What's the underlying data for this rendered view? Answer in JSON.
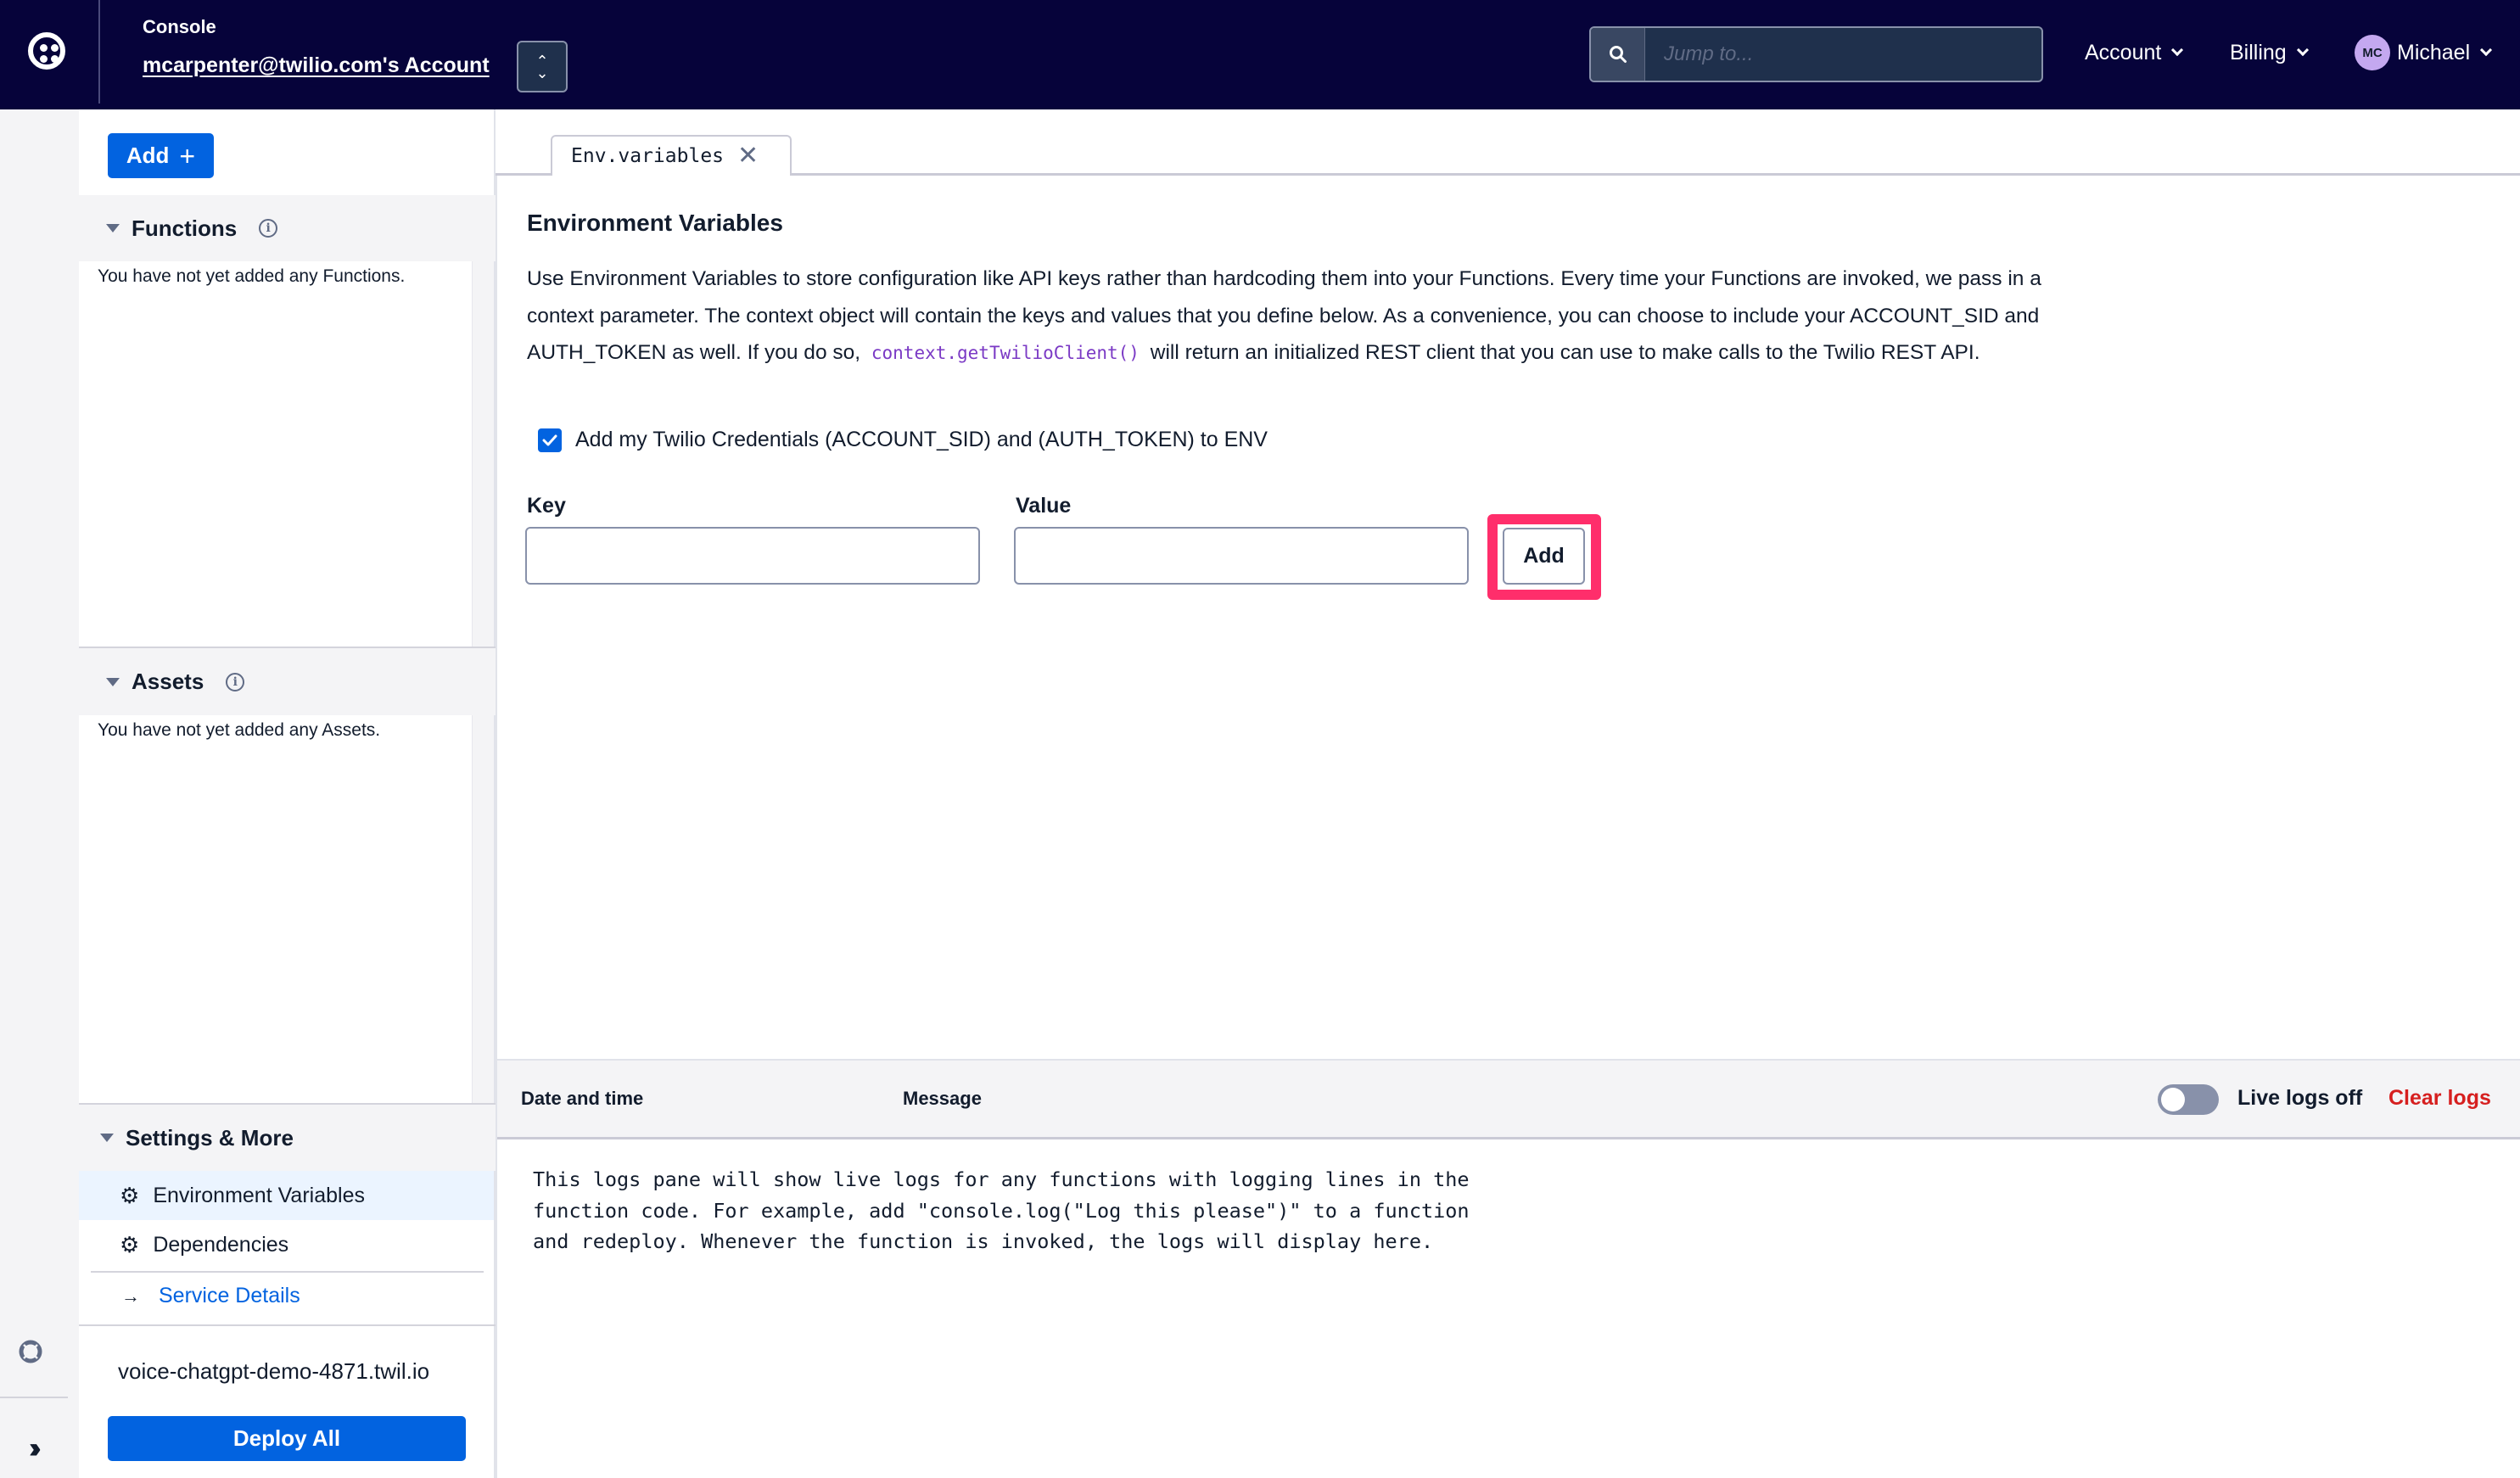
{
  "header": {
    "console_label": "Console",
    "account_name": "mcarpenter@twilio.com's Account",
    "search_placeholder": "Jump to...",
    "menus": [
      {
        "label": "Account"
      },
      {
        "label": "Billing"
      }
    ],
    "user": {
      "initials": "MC",
      "name": "Michael"
    },
    "colors": {
      "background": "#06033a"
    }
  },
  "sidebar": {
    "add_button": "Add",
    "functions": {
      "title": "Functions",
      "empty": "You have not yet added any Functions."
    },
    "assets": {
      "title": "Assets",
      "empty": "You have not yet added any Assets."
    },
    "settings": {
      "title": "Settings & More",
      "items": [
        {
          "label": "Environment Variables",
          "icon": "gear-icon",
          "active": true
        },
        {
          "label": "Dependencies",
          "icon": "gear-icon",
          "active": false
        }
      ],
      "service_details": "Service Details"
    },
    "service_url": "voice-chatgpt-demo-4871.twil.io",
    "deploy_button": "Deploy All"
  },
  "tabs": [
    {
      "label": "Env.variables",
      "closable": true,
      "active": true
    }
  ],
  "env": {
    "title": "Environment Variables",
    "description_before": "Use Environment Variables to store configuration like API keys rather than hardcoding them into your Functions. Every time your Functions are invoked, we pass in a context parameter. The context object will contain the keys and values that you define below. As a convenience, you can choose to include your ACCOUNT_SID and AUTH_TOKEN as well. If you do so,",
    "description_code": "context.getTwilioClient()",
    "description_after": "will return an initialized REST client that you can use to make calls to the Twilio REST API.",
    "credentials_checkbox": {
      "label": "Add my Twilio Credentials (ACCOUNT_SID) and (AUTH_TOKEN) to ENV",
      "checked": true
    },
    "key_label": "Key",
    "key_value": "",
    "value_label": "Value",
    "value_value": "",
    "add_button": "Add",
    "highlight_color": "#ff2e6b"
  },
  "logs": {
    "col_datetime": "Date and time",
    "col_message": "Message",
    "live_toggle": {
      "label": "Live logs off",
      "on": false
    },
    "clear_label": "Clear logs",
    "placeholder": "This logs pane will show live logs for any functions with logging lines in the\nfunction code. For example, add \"console.log(\"Log this please\")\" to a function\nand redeploy. Whenever the function is invoked, the logs will display here."
  }
}
